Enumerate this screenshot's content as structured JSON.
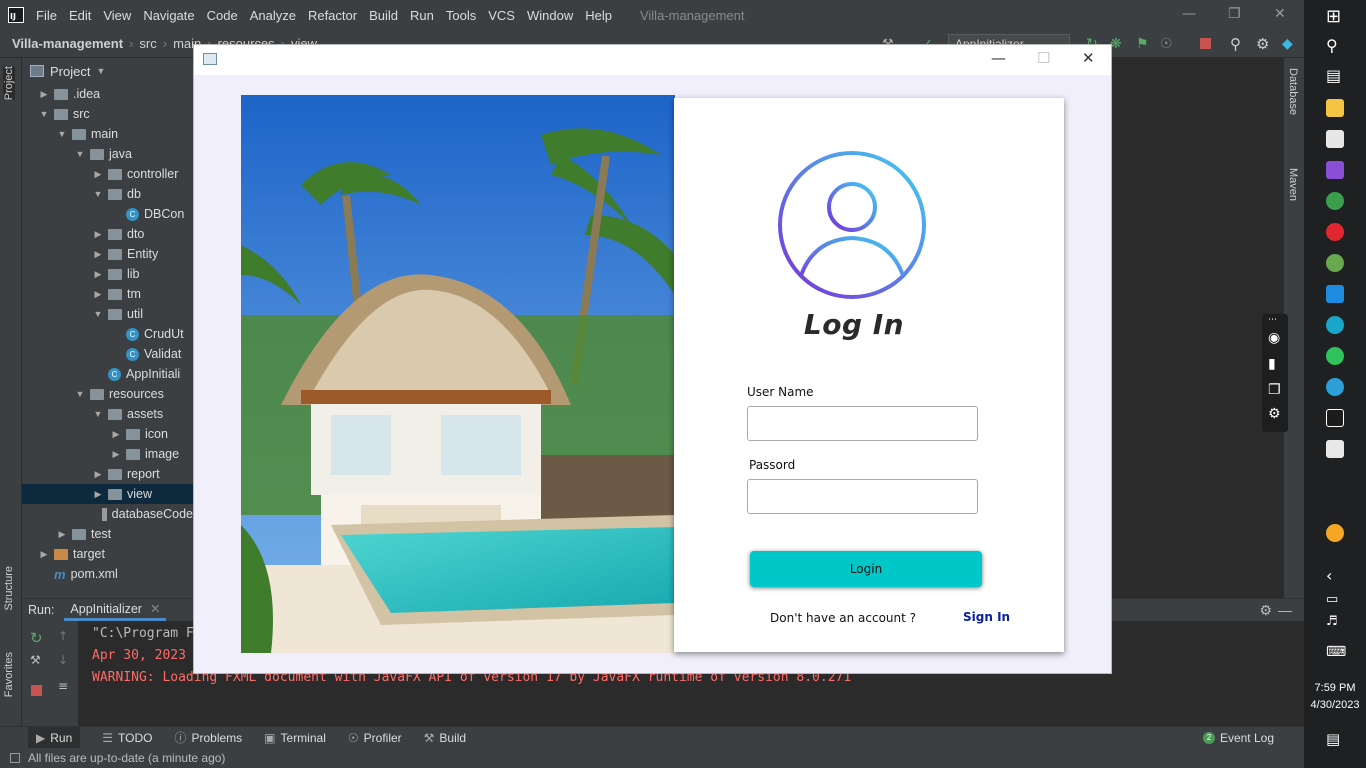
{
  "menubar": {
    "items": [
      "File",
      "Edit",
      "View",
      "Navigate",
      "Code",
      "Analyze",
      "Refactor",
      "Build",
      "Run",
      "Tools",
      "VCS",
      "Window",
      "Help"
    ],
    "project_title": "Villa-management"
  },
  "breadcrumb": [
    "Villa-management",
    "src",
    "main",
    "resources",
    "view"
  ],
  "run_config": "AppInitializer",
  "project_panel": {
    "title": "Project",
    "tree": [
      {
        "label": ".idea",
        "depth": 1,
        "arrow": "right",
        "kind": "folder"
      },
      {
        "label": "src",
        "depth": 1,
        "arrow": "down",
        "kind": "folder"
      },
      {
        "label": "main",
        "depth": 2,
        "arrow": "down",
        "kind": "folder"
      },
      {
        "label": "java",
        "depth": 3,
        "arrow": "down",
        "kind": "folder"
      },
      {
        "label": "controller",
        "depth": 4,
        "arrow": "right",
        "kind": "folder"
      },
      {
        "label": "db",
        "depth": 4,
        "arrow": "down",
        "kind": "folder"
      },
      {
        "label": "DBCon",
        "depth": 5,
        "arrow": "",
        "kind": "class"
      },
      {
        "label": "dto",
        "depth": 4,
        "arrow": "right",
        "kind": "folder"
      },
      {
        "label": "Entity",
        "depth": 4,
        "arrow": "right",
        "kind": "folder"
      },
      {
        "label": "lib",
        "depth": 4,
        "arrow": "right",
        "kind": "folder"
      },
      {
        "label": "tm",
        "depth": 4,
        "arrow": "right",
        "kind": "folder"
      },
      {
        "label": "util",
        "depth": 4,
        "arrow": "down",
        "kind": "folder"
      },
      {
        "label": "CrudUt",
        "depth": 5,
        "arrow": "",
        "kind": "class"
      },
      {
        "label": "Validat",
        "depth": 5,
        "arrow": "",
        "kind": "class"
      },
      {
        "label": "AppInitiali",
        "depth": 4,
        "arrow": "",
        "kind": "class"
      },
      {
        "label": "resources",
        "depth": 3,
        "arrow": "down",
        "kind": "folder"
      },
      {
        "label": "assets",
        "depth": 4,
        "arrow": "down",
        "kind": "folder"
      },
      {
        "label": "icon",
        "depth": 5,
        "arrow": "right",
        "kind": "folder"
      },
      {
        "label": "image",
        "depth": 5,
        "arrow": "right",
        "kind": "folder"
      },
      {
        "label": "report",
        "depth": 4,
        "arrow": "right",
        "kind": "folder"
      },
      {
        "label": "view",
        "depth": 4,
        "arrow": "right",
        "kind": "folder",
        "selected": true
      },
      {
        "label": "databaseCode",
        "depth": 4,
        "arrow": "",
        "kind": "sql"
      },
      {
        "label": "test",
        "depth": 2,
        "arrow": "right",
        "kind": "folder"
      },
      {
        "label": "target",
        "depth": 1,
        "arrow": "right",
        "kind": "orange"
      },
      {
        "label": "pom.xml",
        "depth": 1,
        "arrow": "",
        "kind": "maven"
      }
    ]
  },
  "side_tabs": {
    "left": [
      "Project",
      "Structure",
      "Favorites"
    ],
    "right": [
      "Database",
      "Maven"
    ]
  },
  "run_panel": {
    "label": "Run:",
    "tab": "AppInitializer",
    "console": [
      {
        "text": "\"C:\\Program F",
        "type": "grey"
      },
      {
        "text": "Apr 30, 2023",
        "type": "red"
      },
      {
        "text": "WARNING: Loading FXML document with JavaFX API of version 17 by JavaFX runtime of version 8.0.271",
        "type": "red"
      }
    ]
  },
  "bottom_tabs": [
    "Run",
    "TODO",
    "Problems",
    "Terminal",
    "Profiler",
    "Build"
  ],
  "event_log": {
    "count": "2",
    "label": "Event Log"
  },
  "status": "All files are up-to-date (a minute ago)",
  "login": {
    "title": "Log In",
    "username_label": "User Name",
    "username_value": "",
    "password_label": "Passord",
    "password_value": "",
    "login_button": "Login",
    "no_account": "Don't have an account ?",
    "signin_link": "Sign In",
    "button_color": "#00c8c8",
    "link_color": "#0b1fa0"
  },
  "clock": {
    "time": "7:59 PM",
    "date": "4/30/2023"
  }
}
